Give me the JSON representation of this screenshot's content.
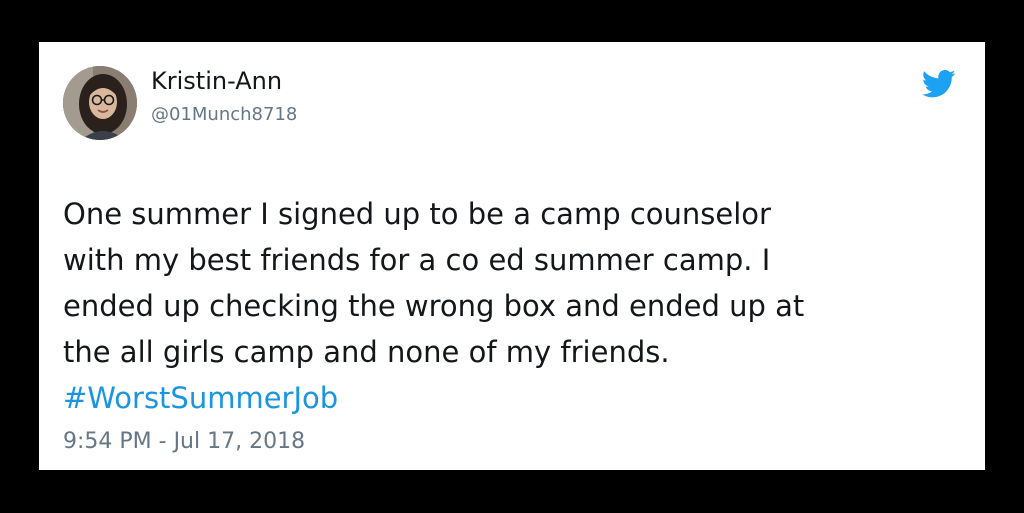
{
  "tweet": {
    "author": {
      "display_name": "Kristin-Ann",
      "handle": "@01Munch8718",
      "avatar_icon": "profile-photo"
    },
    "body_lines": [
      "One summer I signed up to be a camp counselor",
      "with my best friends for a co ed summer camp. I",
      "ended up checking the wrong box and ended up at",
      "the all girls camp and none of my friends."
    ],
    "hashtag": "#WorstSummerJob",
    "timestamp": "9:54 PM - Jul 17, 2018",
    "logo_icon": "twitter-bird"
  },
  "colors": {
    "background": "#000000",
    "card": "#ffffff",
    "text": "#14171a",
    "secondary_text": "#657786",
    "link": "#1b95e0",
    "twitter_blue": "#1da1f2"
  }
}
